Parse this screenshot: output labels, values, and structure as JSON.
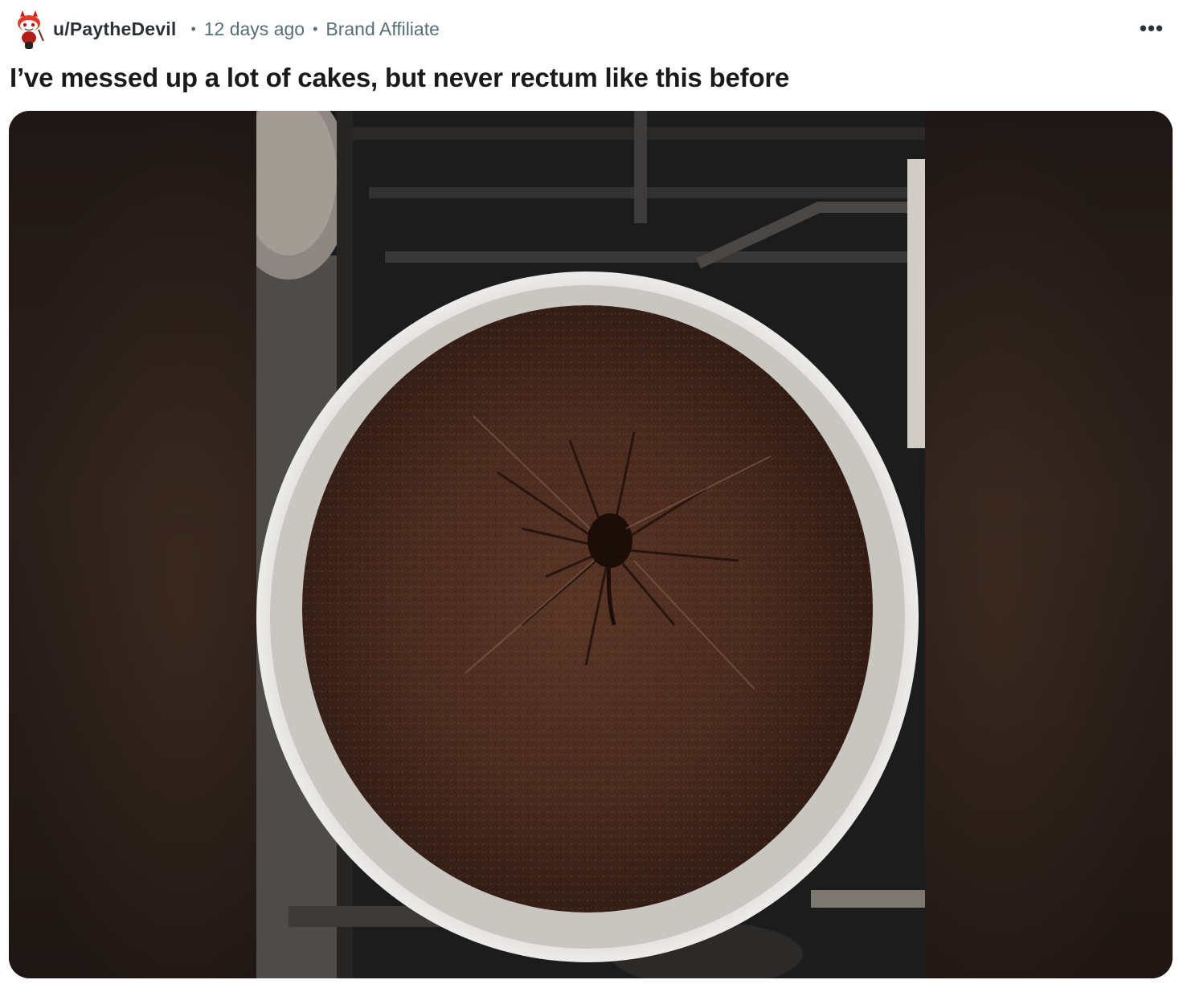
{
  "post": {
    "author": "u/PaytheDevil",
    "separator": "•",
    "time_ago": "12 days ago",
    "flair": "Brand Affiliate",
    "more_label": "•••",
    "title": "I’ve messed up a lot of cakes, but never rectum like this before"
  },
  "icons": {
    "avatar": "reddit-snoo-devil-icon",
    "more": "overflow-menu-icon"
  },
  "colors": {
    "meta_text": "#576f76",
    "username_text": "#2a3236",
    "title_text": "#1a1a1b"
  }
}
